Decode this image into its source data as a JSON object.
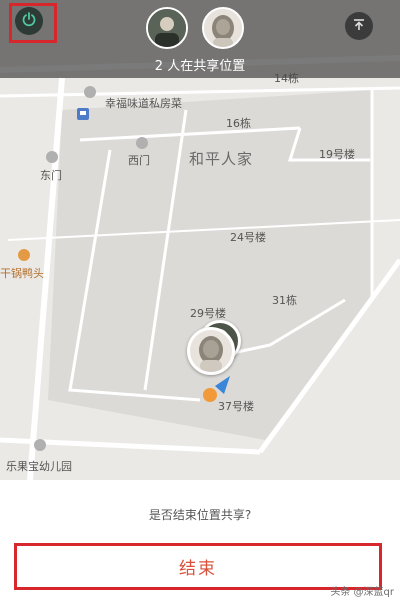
{
  "top_bar": {
    "share_count_text": "2 人在共享位置",
    "power_icon": "power-icon",
    "upload_icon": "upload-top-icon",
    "highlight_color": "#d8262d"
  },
  "map": {
    "labels": {
      "building_14": "14栋",
      "restaurant": "幸福味道私房菜",
      "building_16": "16栋",
      "west_gate": "西门",
      "community": "和平人家",
      "building_19": "19号楼",
      "east_gate": "东门",
      "building_24": "24号楼",
      "restaurant2": "干锅鸭头",
      "building_29": "29号楼",
      "building_31": "31栋",
      "building_37": "37号楼",
      "kindergarten": "乐果宝幼儿园"
    }
  },
  "dialog": {
    "question": "是否结束位置共享?",
    "end_button_label": "结束",
    "accent_color": "#d8262d"
  },
  "watermark": "头条 @深蓝qr"
}
